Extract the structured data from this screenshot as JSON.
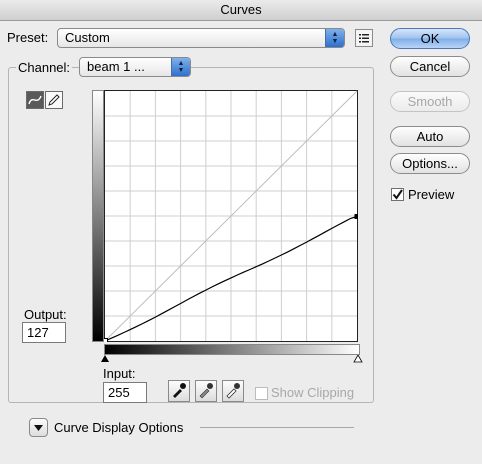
{
  "window": {
    "title": "Curves"
  },
  "preset": {
    "label": "Preset:",
    "value": "Custom"
  },
  "channel": {
    "label": "Channel:",
    "value": "beam 1 ..."
  },
  "buttons": {
    "ok": "OK",
    "cancel": "Cancel",
    "smooth": "Smooth",
    "auto": "Auto",
    "options": "Options..."
  },
  "preview": {
    "label": "Preview",
    "checked": true
  },
  "output": {
    "label": "Output:",
    "value": "127"
  },
  "input": {
    "label": "Input:",
    "value": "255"
  },
  "show_clipping": {
    "label": "Show Clipping",
    "checked": false,
    "enabled": false
  },
  "curve_display_options": {
    "label": "Curve Display Options"
  },
  "icons": {
    "preset_menu": "list-menu-icon",
    "curve_tool": "curve-tool-icon",
    "pencil_tool": "pencil-icon",
    "black_point": "eyedropper-black-icon",
    "gray_point": "eyedropper-gray-icon",
    "white_point": "eyedropper-white-icon",
    "disclosure": "disclosure-triangle-icon"
  },
  "curve": {
    "points": [
      [
        0,
        0
      ],
      [
        255,
        127
      ]
    ],
    "range": [
      0,
      255
    ]
  }
}
